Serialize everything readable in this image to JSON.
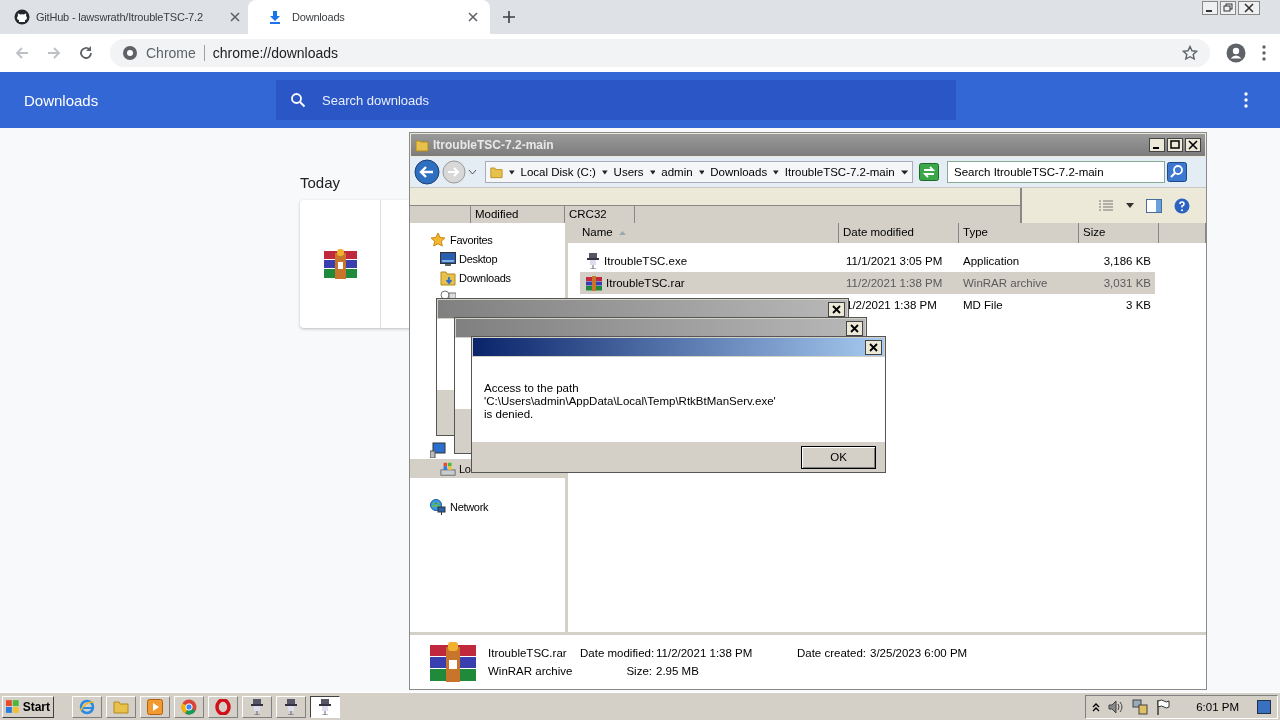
{
  "browser": {
    "tabs": [
      {
        "title": "GitHub - lawswrath/ItroubleTSC-7.2",
        "kind": "github",
        "selected": false
      },
      {
        "title": "Downloads",
        "kind": "download",
        "selected": true
      }
    ],
    "omnibox": {
      "site": "Chrome",
      "url": "chrome://downloads"
    }
  },
  "downloads_page": {
    "title": "Downloads",
    "search": {
      "placeholder": "Search downloads"
    },
    "section": "Today"
  },
  "explorer": {
    "title": "ItroubleTSC-7.2-main",
    "breadcrumb": [
      "Local Disk (C:)",
      "Users",
      "admin",
      "Downloads",
      "ItroubleTSC-7.2-main"
    ],
    "search": {
      "placeholder": "Search ItroubleTSC-7.2-main"
    },
    "extra_columns": [
      "Modified",
      "CRC32"
    ],
    "nav_groups": [
      {
        "items": [
          {
            "label": "Favorites",
            "kind": "star",
            "selected": false
          },
          {
            "label": "Desktop",
            "kind": "desktop",
            "selected": false
          },
          {
            "label": "Downloads",
            "kind": "downloads",
            "selected": false
          },
          {
            "kind": "recent",
            "selected": false
          }
        ]
      },
      {
        "items": [
          {
            "kind": "computer",
            "selected": false
          },
          {
            "label": "Lo",
            "kind": "disk",
            "selected": true
          }
        ]
      },
      {
        "items": [
          {
            "label": "Network",
            "kind": "network",
            "selected": false
          }
        ]
      }
    ],
    "columns": [
      "Name",
      "Date modified",
      "Type",
      "Size"
    ],
    "files": [
      {
        "name": "ItroubleTSC.exe",
        "kind": "exe",
        "date": "11/1/2021 3:05 PM",
        "type": "Application",
        "size": "3,186 KB",
        "selected": false
      },
      {
        "name": "ItroubleTSC.rar",
        "kind": "rar",
        "date": "11/2/2021 1:38 PM",
        "type": "WinRAR archive",
        "size": "3,031 KB",
        "selected": true
      },
      {
        "date": "1/2/2021 1:38 PM",
        "type": "MD File",
        "size": "3 KB",
        "selected": false
      }
    ],
    "details": {
      "name": "ItroubleTSC.rar",
      "type": "WinRAR archive",
      "modified_label": "Date modified:",
      "modified": "11/2/2021 1:38 PM",
      "size_label": "Size:",
      "size": "2.95 MB",
      "created_label": "Date created:",
      "created": "3/25/2023 6:00 PM"
    }
  },
  "dialogs": [
    {
      "active": false
    },
    {
      "active": false
    },
    {
      "lines": [
        "Access to the path 'C:\\Users\\admin\\AppData\\Local\\Temp\\RtkBtManServ.exe'",
        "is denied."
      ],
      "button": "OK",
      "active": true
    }
  ],
  "taskbar": {
    "start": "Start",
    "items": [
      {
        "kind": "ie",
        "selected": false
      },
      {
        "kind": "folder",
        "selected": false
      },
      {
        "kind": "media",
        "selected": false
      },
      {
        "kind": "chrome",
        "selected": false
      },
      {
        "kind": "opera",
        "selected": false
      },
      {
        "kind": "app",
        "selected": false
      },
      {
        "kind": "app",
        "selected": false
      },
      {
        "kind": "app",
        "selected": true
      }
    ],
    "clock": "6:01 PM"
  }
}
